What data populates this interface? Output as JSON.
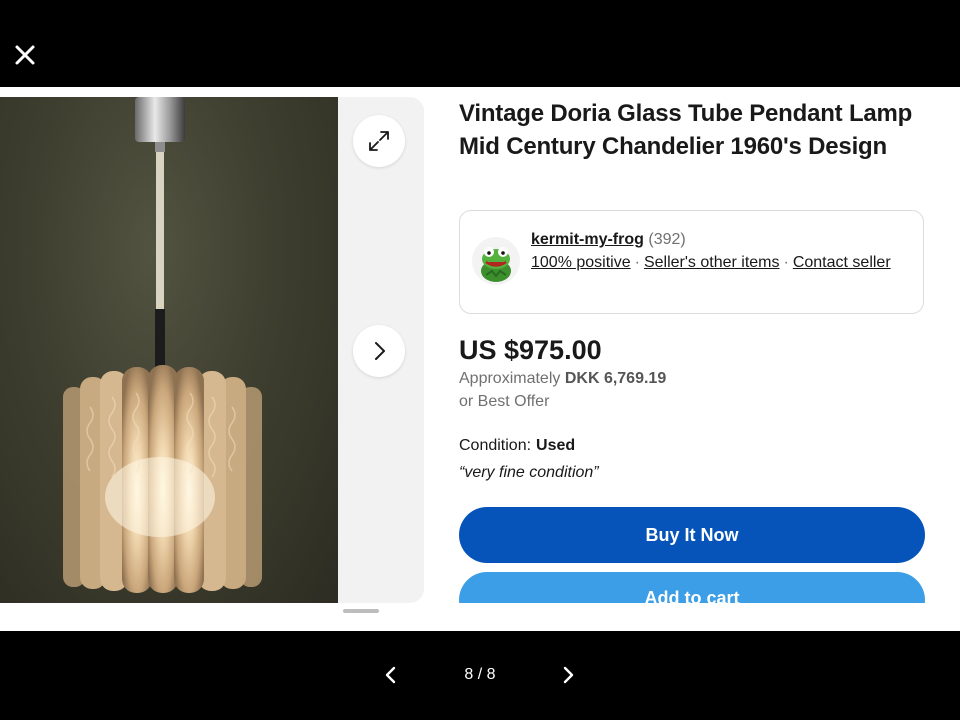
{
  "viewer": {
    "close_icon": "close-icon",
    "counter": "8 / 8",
    "prev_icon": "chevron-left-icon",
    "next_icon": "chevron-right-icon"
  },
  "gallery": {
    "expand_icon": "expand-icon",
    "next_icon": "chevron-right-icon"
  },
  "listing": {
    "title": "Vintage Doria Glass Tube Pendant Lamp Mid Century Chandelier 1960's Design",
    "seller": {
      "name": "kermit-my-frog",
      "feedback_count": "(392)",
      "positive": "100% positive",
      "other_items": "Seller's other items",
      "contact": "Contact seller"
    },
    "price": "US $975.00",
    "approx_label": "Approximately",
    "approx_value": "DKK 6,769.19",
    "best_offer": "or Best Offer",
    "condition_label": "Condition:",
    "condition_value": "Used",
    "condition_quote": "“very fine condition”",
    "buy_now": "Buy It Now",
    "add_to_cart": "Add to cart"
  },
  "colors": {
    "buy_now": "#0654ba",
    "add_to_cart": "#3b9ee6",
    "text": "#191919",
    "muted": "#707070"
  }
}
